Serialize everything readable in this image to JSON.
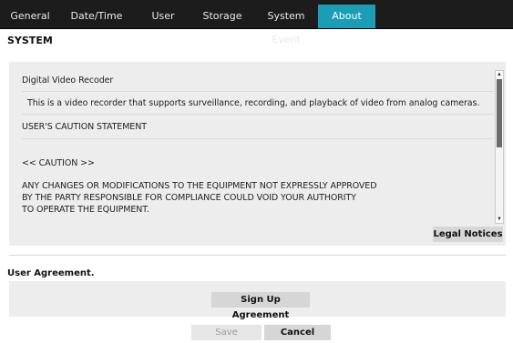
{
  "tabs": [
    {
      "label": "General",
      "active": false
    },
    {
      "label": "Date/Time",
      "active": false
    },
    {
      "label": "User",
      "active": false
    },
    {
      "label": "Storage",
      "active": false
    },
    {
      "label": "System Event",
      "active": false
    },
    {
      "label": "About",
      "active": true
    }
  ],
  "section_title": "SYSTEM",
  "info_text": {
    "product": "Digital Video Recoder",
    "description": "This is a video recorder that supports surveillance, recording, and playback of video from analog cameras.",
    "caution_statement": "USER'S CAUTION STATEMENT",
    "caution_header": "<< CAUTION >>",
    "caution_line1": "ANY CHANGES OR MODIFICATIONS TO THE EQUIPMENT NOT EXPRESSLY APPROVED",
    "caution_line2": "BY THE PARTY RESPONSIBLE FOR COMPLIANCE COULD VOID YOUR AUTHORITY",
    "caution_line3": "TO OPERATE THE EQUIPMENT."
  },
  "buttons": {
    "legal_notices": "Legal Notices",
    "sign_up": "Sign Up Agreement",
    "save": "Save",
    "cancel": "Cancel"
  },
  "agreement_title": "User Agreement.",
  "colors": {
    "tabbar_bg": "#1c1c1c",
    "active_tab": "#1b9db6",
    "panel_bg": "#ededed"
  },
  "icons": {
    "scroll_up": "scroll-up-arrow-icon",
    "scroll_down": "scroll-down-arrow-icon"
  }
}
